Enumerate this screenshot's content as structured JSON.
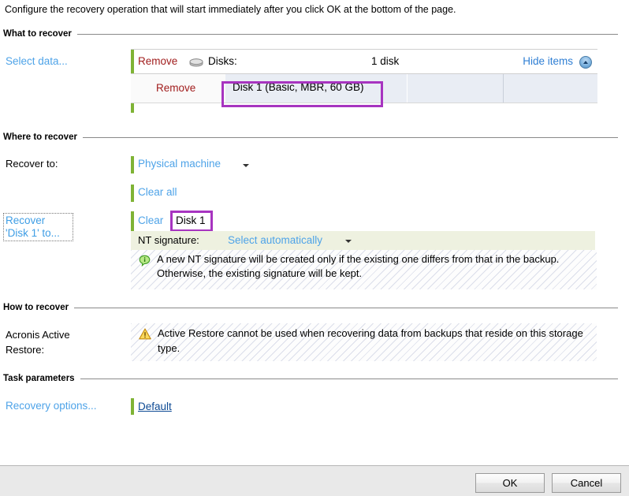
{
  "intro": "Configure the recovery operation that will start immediately after you click OK at the bottom of the page.",
  "sections": {
    "what_to_recover": "What to recover",
    "where_to_recover": "Where to recover",
    "how_to_recover": "How to recover",
    "task_parameters": "Task parameters"
  },
  "what_to_recover": {
    "select_data_link": "Select data...",
    "remove_link": "Remove",
    "disks_label": "Disks:",
    "disks_count": "1 disk",
    "hide_items": "Hide items",
    "disk_icon_name": "disk-icon",
    "collapse_icon_name": "chevron-up-circle-icon",
    "row": {
      "remove_link": "Remove",
      "disk_name": "Disk 1 (Basic, MBR, 60 GB)"
    }
  },
  "where_to_recover": {
    "recover_to_label": "Recover to:",
    "recover_to_value": "Physical machine",
    "clear_all": "Clear all",
    "recover_disk_link": "Recover\n'Disk 1' to...",
    "clear_link": "Clear",
    "disk_target": "Disk 1",
    "nt_signature_label": "NT signature:",
    "nt_signature_value": "Select automatically",
    "info_icon_name": "info-bubble-icon",
    "info_text": "A new NT signature will be created only if the existing one differs from that in the backup. Otherwise, the existing signature will be kept."
  },
  "how_to_recover": {
    "active_restore_label": "Acronis Active\nRestore:",
    "warning_icon_name": "warning-triangle-icon",
    "warning_text": "Active Restore cannot be used when recovering data from backups that reside on this storage type."
  },
  "task_parameters": {
    "recovery_options_link": "Recovery options...",
    "default_value": "Default"
  },
  "buttons": {
    "ok": "OK",
    "cancel": "Cancel"
  },
  "colors": {
    "accent_green": "#7fb335",
    "accent_orange": "#f08c1b",
    "link_blue": "#4ea3e8",
    "remove_red": "#a11d1d",
    "highlight_purple": "#a734c0",
    "nt_row_bg": "#eef1e0"
  }
}
